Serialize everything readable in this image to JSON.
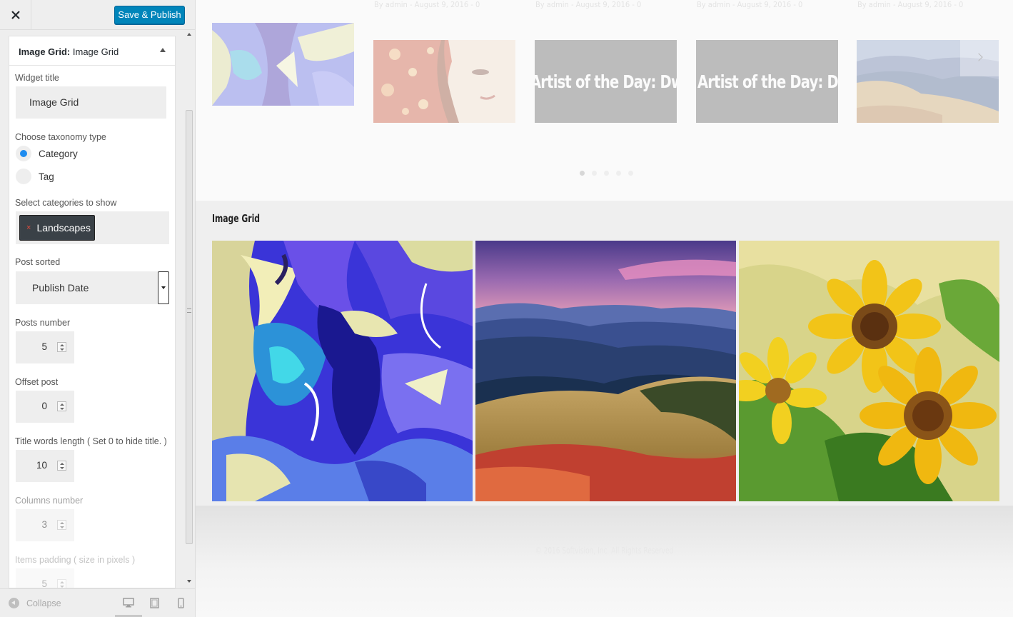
{
  "header": {
    "close_label": "Close",
    "save_label": "Save & Publish"
  },
  "widget": {
    "type_label": "Image Grid:",
    "instance_title": "Image Grid",
    "fields": {
      "widget_title_label": "Widget title",
      "widget_title_value": "Image Grid",
      "taxonomy_label": "Choose taxonomy type",
      "taxonomy_options": [
        "Category",
        "Tag"
      ],
      "taxonomy_selected": "Category",
      "categories_label": "Select categories to show",
      "categories_selected": [
        "Landscapes"
      ],
      "remove_symbol": "×",
      "sort_label": "Post sorted",
      "sort_value": "Publish Date",
      "posts_number_label": "Posts number",
      "posts_number_value": "5",
      "offset_label": "Offset post",
      "offset_value": "0",
      "title_words_label": "Title words length ( Set 0 to hide title. )",
      "title_words_value": "10",
      "columns_label": "Columns number",
      "columns_value": "3",
      "padding_label": "Items padding ( size in pixels )",
      "padding_value": "5"
    }
  },
  "footer": {
    "collapse_label": "Collapse",
    "devices": [
      "desktop",
      "tablet",
      "mobile"
    ],
    "active_device": "desktop"
  },
  "preview": {
    "slider": {
      "meta": [
        "By admin - August 9, 2016 - 0",
        "By admin - August 9, 2016 - 0",
        "By admin - August 9, 2016 - 0",
        "By admin - August 9, 2016 - 0"
      ],
      "slides": [
        {
          "kind": "image",
          "icon": "abstract-painting-image"
        },
        {
          "kind": "image",
          "icon": "woman-portrait-painting-image"
        },
        {
          "kind": "text",
          "title": "Artist of the Day: Dwyer K"
        },
        {
          "kind": "text",
          "title": "Artist of the Day: Dean B"
        },
        {
          "kind": "image",
          "icon": "mountain-landscape-image"
        }
      ],
      "dot_count": 5,
      "active_dot": 0
    },
    "image_grid": {
      "title": "Image Grid",
      "images": [
        "abstract-blue-painting",
        "mountain-sunset-landscape",
        "sunflowers-painting"
      ]
    },
    "copyright": "© 2016 Softvision, Inc. All Rights Reserved"
  },
  "colors": {
    "primary_button": "#0085ba",
    "radio_selected": "#1e8cf0",
    "tag_bg": "#3a4147",
    "tag_remove": "#e74c3c"
  }
}
